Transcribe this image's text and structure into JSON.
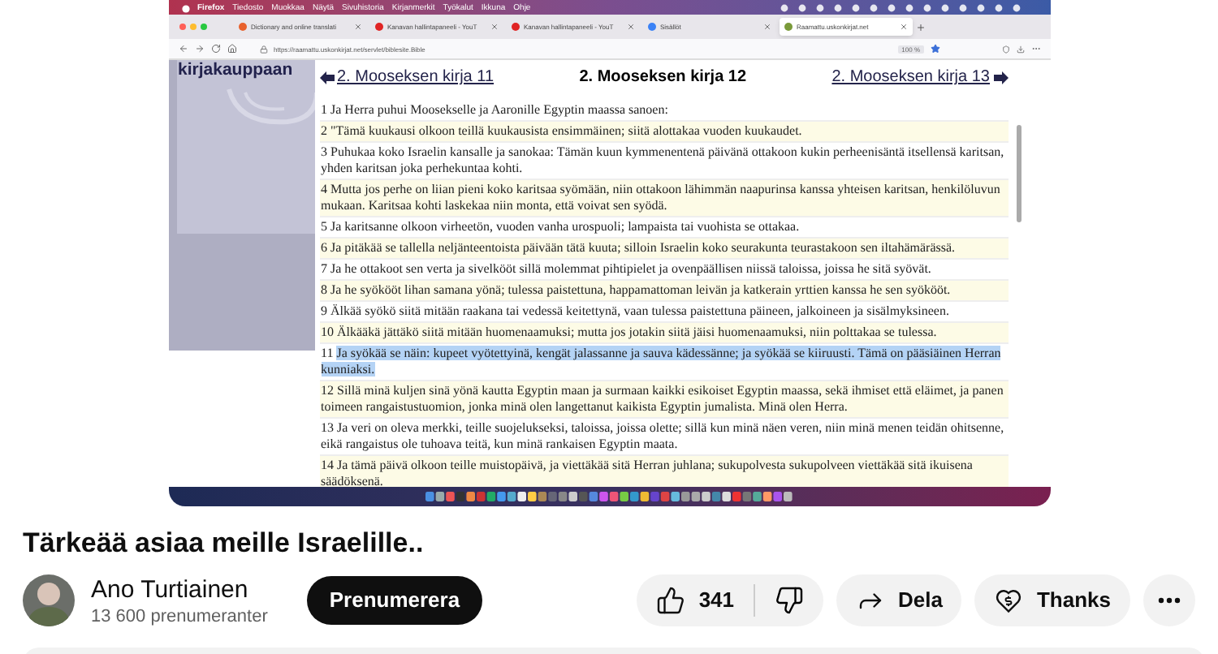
{
  "video": {
    "menu_bar": {
      "items": [
        "Firefox",
        "Tiedosto",
        "Muokkaa",
        "Näytä",
        "Sivuhistoria",
        "Kirjanmerkit",
        "Työkalut",
        "Ikkuna",
        "Ohje"
      ]
    },
    "tabs": [
      {
        "title": "Dictionary and online translati",
        "color": "#e8612c",
        "selected": false
      },
      {
        "title": "Kanavan hallintapaneeli - YouT",
        "color": "#e02424",
        "selected": false
      },
      {
        "title": "Kanavan hallintapaneeli - YouT",
        "color": "#e02424",
        "selected": false
      },
      {
        "title": "Sisällöt",
        "color": "#3b82f6",
        "selected": false
      },
      {
        "title": "Raamattu.uskonkirjat.net",
        "color": "#7a9a3a",
        "selected": true
      }
    ],
    "address_bar": {
      "url": "https://raamattu.uskonkirjat.net/servlet/biblesite.Bible",
      "zoom": "100 %"
    },
    "page": {
      "sidebar_heading": "kirjakauppaan",
      "nav": {
        "previous": "2. Mooseksen kirja 11",
        "title": "2. Mooseksen kirja 12",
        "next": "2. Mooseksen kirja 13"
      },
      "verses": [
        {
          "number": "1",
          "text": "Ja Herra puhui Moosekselle ja Aaronille Egyptin maassa sanoen:",
          "highlighted": false
        },
        {
          "number": "2",
          "text": "\"Tämä kuukausi olkoon teillä kuukausista ensimmäinen; siitä alottakaa vuoden kuukaudet.",
          "highlighted": false
        },
        {
          "number": "3",
          "text": "Puhukaa koko Israelin kansalle ja sanokaa: Tämän kuun kymmenentenä päivänä ottakoon kukin perheenisäntä itsellensä karitsan, yhden karitsan joka perhekuntaa kohti.",
          "highlighted": false
        },
        {
          "number": "4",
          "text": "Mutta jos perhe on liian pieni koko karitsaa syömään, niin ottakoon lähimmän naapurinsa kanssa yhteisen karitsan, henkilöluvun mukaan. Karitsaa kohti laskekaa niin monta, että voivat sen syödä.",
          "highlighted": false
        },
        {
          "number": "5",
          "text": "Ja karitsanne olkoon virheetön, vuoden vanha urospuoli; lampaista tai vuohista se ottakaa.",
          "highlighted": false
        },
        {
          "number": "6",
          "text": "Ja pitäkää se tallella neljänteentoista päivään tätä kuuta; silloin Israelin koko seurakunta teurastakoon sen iltahämärässä.",
          "highlighted": false
        },
        {
          "number": "7",
          "text": "Ja he ottakoot sen verta ja sivelkööt sillä molemmat pihtipielet ja ovenpäällisen niissä taloissa, joissa he sitä syövät.",
          "highlighted": false
        },
        {
          "number": "8",
          "text": "Ja he syökööt lihan samana yönä; tulessa paistettuna, happamattoman leivän ja katkerain yrttien kanssa he sen syökööt.",
          "highlighted": false
        },
        {
          "number": "9",
          "text": "Älkää syökö siitä mitään raakana tai vedessä keitettynä, vaan tulessa paistettuna päineen, jalkoineen ja sisälmyksineen.",
          "highlighted": false
        },
        {
          "number": "10",
          "text": "Älkääkä jättäkö siitä mitään huomenaamuksi; mutta jos jotakin siitä jäisi huomenaamuksi, niin polttakaa se tulessa.",
          "highlighted": false
        },
        {
          "number": "11",
          "text": "Ja syökää se näin: kupeet vyötettyinä, kengät jalassanne ja sauva kädessänne; ja syökää se kiiruusti. Tämä on pääsiäinen Herran kunniaksi.",
          "highlighted": true
        },
        {
          "number": "12",
          "text": "Sillä minä kuljen sinä yönä kautta Egyptin maan ja surmaan kaikki esikoiset Egyptin maassa, sekä ihmiset että eläimet, ja panen toimeen rangaistustuomion, jonka minä olen langettanut kaikista Egyptin jumalista. Minä olen Herra.",
          "highlighted": false
        },
        {
          "number": "13",
          "text": "Ja veri on oleva merkki, teille suojelukseksi, taloissa, joissa olette; sillä kun minä näen veren, niin minä menen teidän ohitsenne, eikä rangaistus ole tuhoava teitä, kun minä rankaisen Egyptin maata.",
          "highlighted": false
        },
        {
          "number": "14",
          "text": "Ja tämä päivä olkoon teille muistopäivä, ja viettäkää sitä Herran juhlana; sukupolvesta sukupolveen viettäkää sitä ikuisena säädöksenä.",
          "highlighted": false
        }
      ]
    }
  },
  "video_title": "Tärkeää asiaa meille Israelille..",
  "channel": {
    "name": "Ano Turtiainen",
    "subscribers": "13 600 prenumeranter"
  },
  "subscribe_button": "Prenumerera",
  "actions": {
    "likes": "341",
    "share": "Dela",
    "thanks": "Thanks"
  }
}
